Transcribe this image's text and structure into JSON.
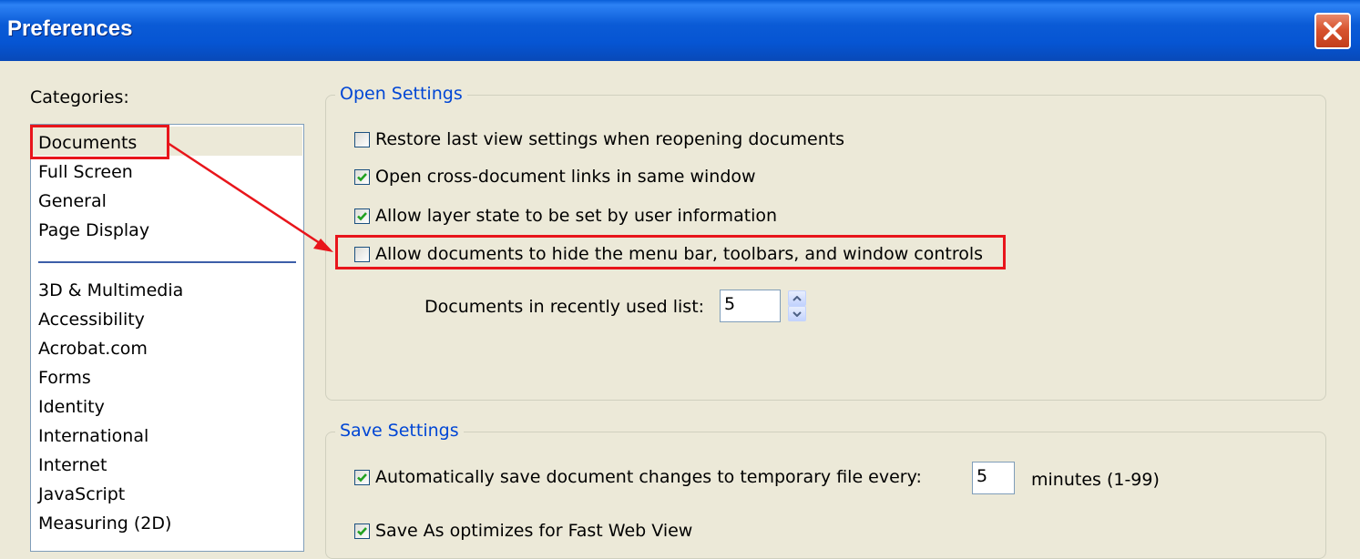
{
  "window": {
    "title": "Preferences"
  },
  "categories": {
    "label": "Categories:",
    "group1": [
      "Documents",
      "Full Screen",
      "General",
      "Page Display"
    ],
    "group2": [
      "3D & Multimedia",
      "Accessibility",
      "Acrobat.com",
      "Forms",
      "Identity",
      "International",
      "Internet",
      "JavaScript",
      "Measuring (2D)"
    ],
    "selected": "Documents"
  },
  "open_settings": {
    "legend": "Open Settings",
    "options": [
      {
        "label": "Restore last view settings when reopening documents",
        "checked": false
      },
      {
        "label": "Open cross-document links in same window",
        "checked": true
      },
      {
        "label": "Allow layer state to be set by user information",
        "checked": true
      },
      {
        "label": "Allow documents to hide the menu bar, toolbars, and window controls",
        "checked": false
      }
    ],
    "recent_list_label": "Documents in recently used list:",
    "recent_list_value": "5"
  },
  "save_settings": {
    "legend": "Save Settings",
    "autosave_label": "Automatically save document changes to temporary file every:",
    "autosave_checked": true,
    "autosave_value": "5",
    "autosave_unit": "minutes (1-99)",
    "fast_web_label": "Save As optimizes for Fast Web View",
    "fast_web_checked": true
  },
  "annotation": {
    "highlight_color": "#e8151b"
  }
}
